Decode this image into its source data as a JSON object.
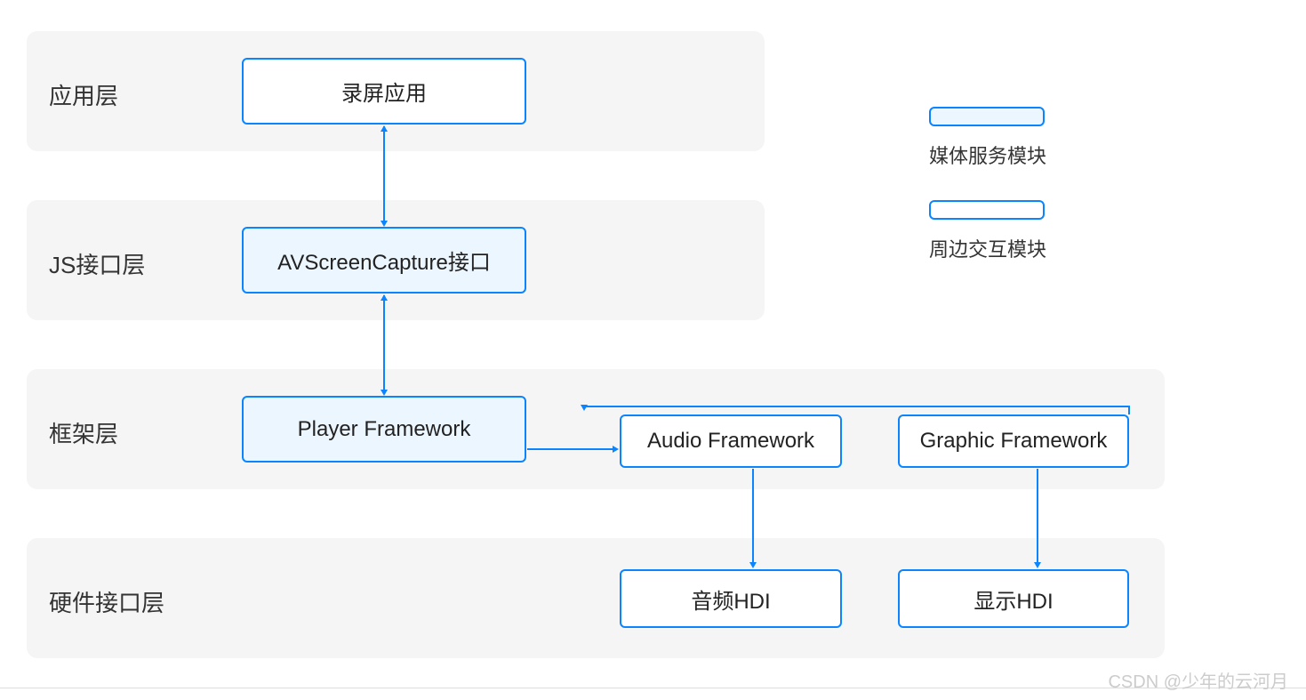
{
  "layers": {
    "app": {
      "label": "应用层"
    },
    "js": {
      "label": "JS接口层"
    },
    "fw": {
      "label": "框架层"
    },
    "hw": {
      "label": "硬件接口层"
    }
  },
  "nodes": {
    "screen_app": "录屏应用",
    "avscreen_api": "AVScreenCapture接口",
    "player_fw": "Player Framework",
    "audio_fw": "Audio Framework",
    "graphic_fw": "Graphic Framework",
    "audio_hdi": "音频HDI",
    "display_hdi": "显示HDI"
  },
  "legend": {
    "media_module": "媒体服务模块",
    "peripheral_module": "周边交互模块"
  },
  "watermark": "CSDN @少年的云河月",
  "colors": {
    "band_bg": "#f5f5f5",
    "border": "#0a84ff",
    "filled": "#ecf6ff",
    "arrow": "#0a84ff"
  }
}
